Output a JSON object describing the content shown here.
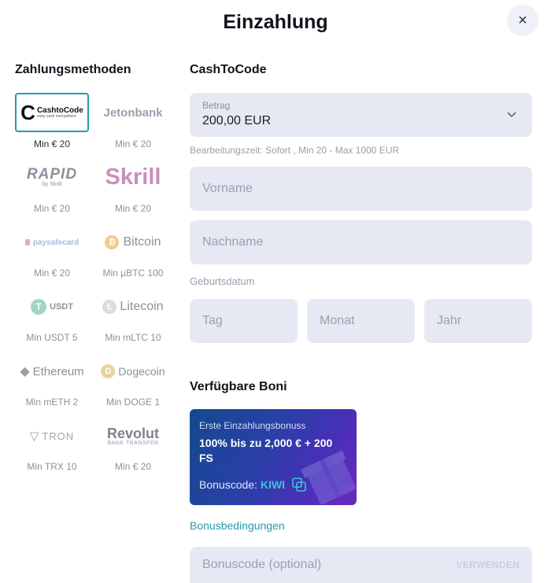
{
  "header": {
    "title": "Einzahlung",
    "close_label": "×"
  },
  "methods": {
    "heading": "Zahlungsmethoden",
    "items": [
      {
        "logo": "CashtoCode",
        "tagline": "easy cash everywhere",
        "min": "Min € 20"
      },
      {
        "logo": "Jetonbank",
        "min": "Min € 20"
      },
      {
        "logo": "RAPID",
        "sublogo": "by Skrill",
        "min": "Min € 20"
      },
      {
        "logo": "Skrill",
        "min": "Min € 20"
      },
      {
        "logo": "paysafecard",
        "min": "Min € 20"
      },
      {
        "logo": "Bitcoin",
        "min": "Min µBTC 100"
      },
      {
        "logo": "USDT",
        "min": "Min USDT 5"
      },
      {
        "logo": "Litecoin",
        "min": "Min mLTC 10"
      },
      {
        "logo": "Ethereum",
        "min": "Min mETH 2"
      },
      {
        "logo": "Dogecoin",
        "min": "Min DOGE 1"
      },
      {
        "logo": "TRON",
        "min": "Min TRX 10"
      },
      {
        "logo": "Revolut",
        "sublogo": "BANK TRANSFER",
        "min": "Min € 20"
      }
    ]
  },
  "form": {
    "heading": "CashToCode",
    "amount_label": "Betrag",
    "amount_value": "200,00 EUR",
    "processing_hint": "Bearbeitungszeit: Sofort , Min 20 - Max 1000 EUR",
    "first_name_placeholder": "Vorname",
    "last_name_placeholder": "Nachname",
    "birthdate_label": "Geburtsdatum",
    "day_placeholder": "Tag",
    "month_placeholder": "Monat",
    "year_placeholder": "Jahr"
  },
  "bonus": {
    "heading": "Verfügbare Boni",
    "card_title": "Erste Einzahlungsbonuss",
    "card_offer": "100% bis zu 2,000 € + 200 FS",
    "code_label": "Bonuscode:",
    "code_value": "KIWI",
    "terms_link": "Bonusbedingungen",
    "code_placeholder": "Bonuscode (optional)",
    "apply_label": "VERWENDEN"
  },
  "colors": {
    "accent": "#2a9aa8",
    "field_bg": "#e6e9f4",
    "skrill": "#8a1e6e",
    "bitcoin": "#f7931a",
    "usdt": "#26a17b"
  }
}
